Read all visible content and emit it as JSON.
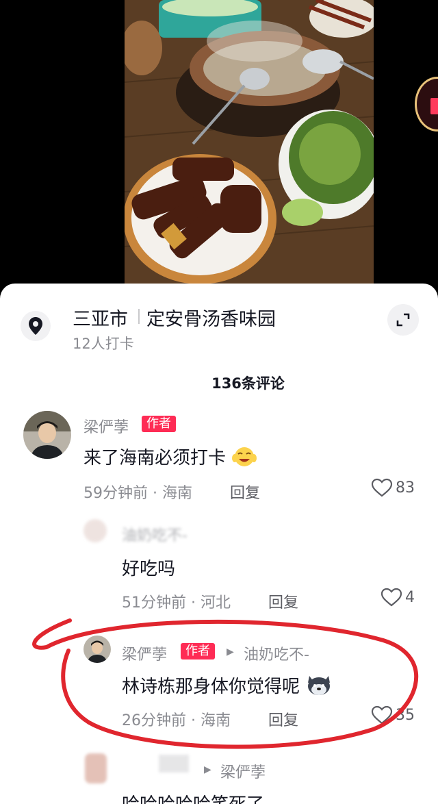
{
  "location": {
    "city": "三亚市",
    "place": "定安骨汤香味园",
    "checkins": "12人打卡"
  },
  "comments_header": "136条评论",
  "comments": [
    {
      "user": "梁俨荸",
      "tag": "作者",
      "text": "来了海南必须打卡",
      "emoji": "laughing-emoji",
      "meta": "59分钟前 · 海南",
      "reply_label": "回复",
      "likes": "83"
    },
    {
      "user": "油奶吃不-",
      "text": "好吃吗",
      "meta": "51分钟前 · 河北",
      "reply_label": "回复",
      "likes": "4"
    },
    {
      "user": "梁俨荸",
      "tag": "作者",
      "reply_to": "油奶吃不-",
      "text": "林诗栋那身体你觉得呢",
      "emoji": "husky-emoji",
      "meta": "26分钟前 · 海南",
      "reply_label": "回复",
      "likes": "35"
    },
    {
      "reply_to": "梁俨荸",
      "text": "哈哈哈哈哈笑死了"
    }
  ],
  "colors": {
    "accent": "#fe2c55",
    "highlight_annotation": "#e0262e"
  }
}
